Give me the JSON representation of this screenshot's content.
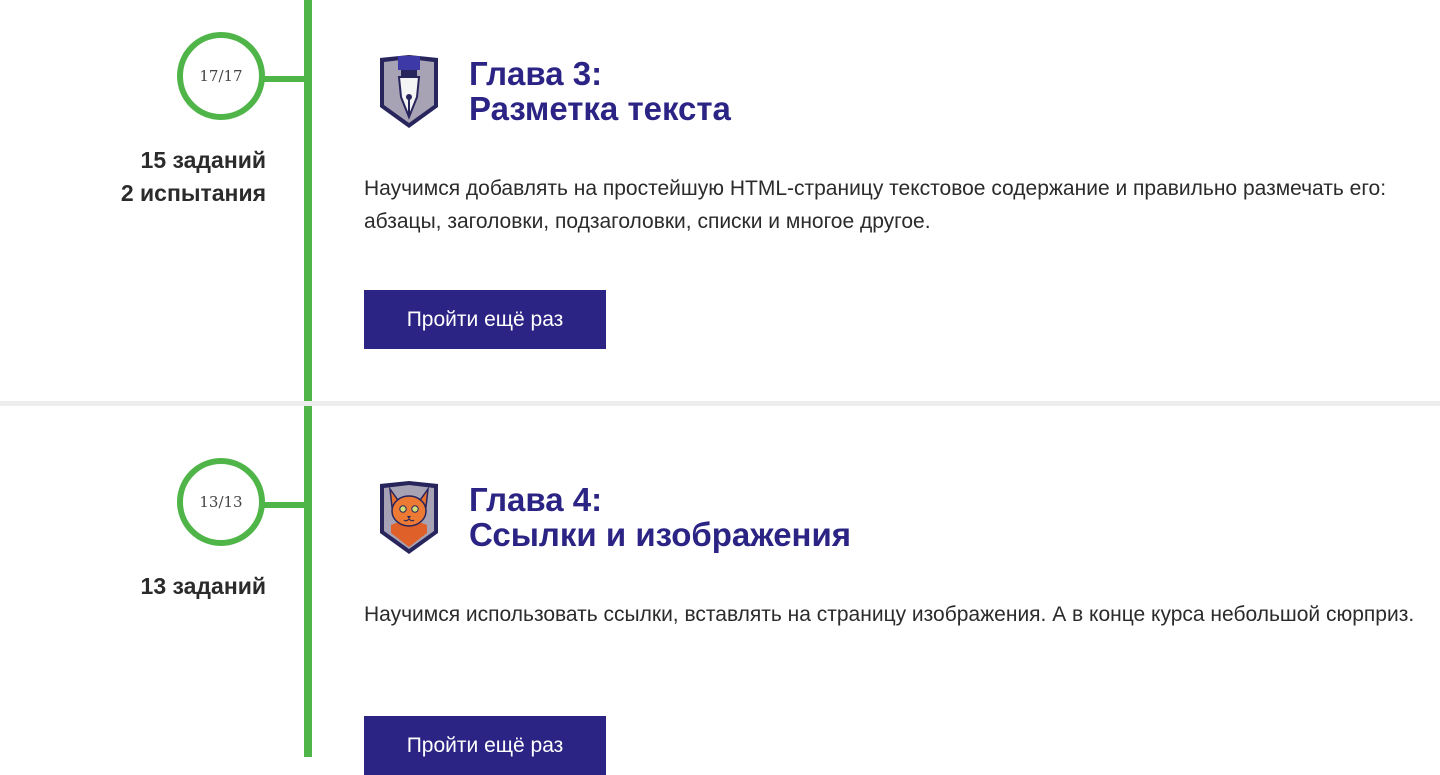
{
  "chapters": [
    {
      "progress": "17/17",
      "stats": [
        "15 заданий",
        "2 испытания"
      ],
      "title_line1": "Глава 3:",
      "title_line2": "Разметка текста",
      "description": "Научимся добавлять на простейшую HTML-страницу текстовое содержание и правильно размечать его: абзацы, заголовки, подзаголовки, списки и многое другое.",
      "button_label": "Пройти ещё раз",
      "badge_icon": "fountain-pen-icon"
    },
    {
      "progress": "13/13",
      "stats": [
        "13 заданий"
      ],
      "title_line1": "Глава 4:",
      "title_line2": "Ссылки и изображения",
      "description": "Научимся использовать ссылки, вставлять на страницу изображения. А в конце курса небольшой сюрприз.",
      "button_label": "Пройти ещё раз",
      "badge_icon": "cat-icon"
    }
  ],
  "colors": {
    "accent_green": "#4fb548",
    "brand_purple": "#2b2484",
    "divider": "#ededed"
  }
}
